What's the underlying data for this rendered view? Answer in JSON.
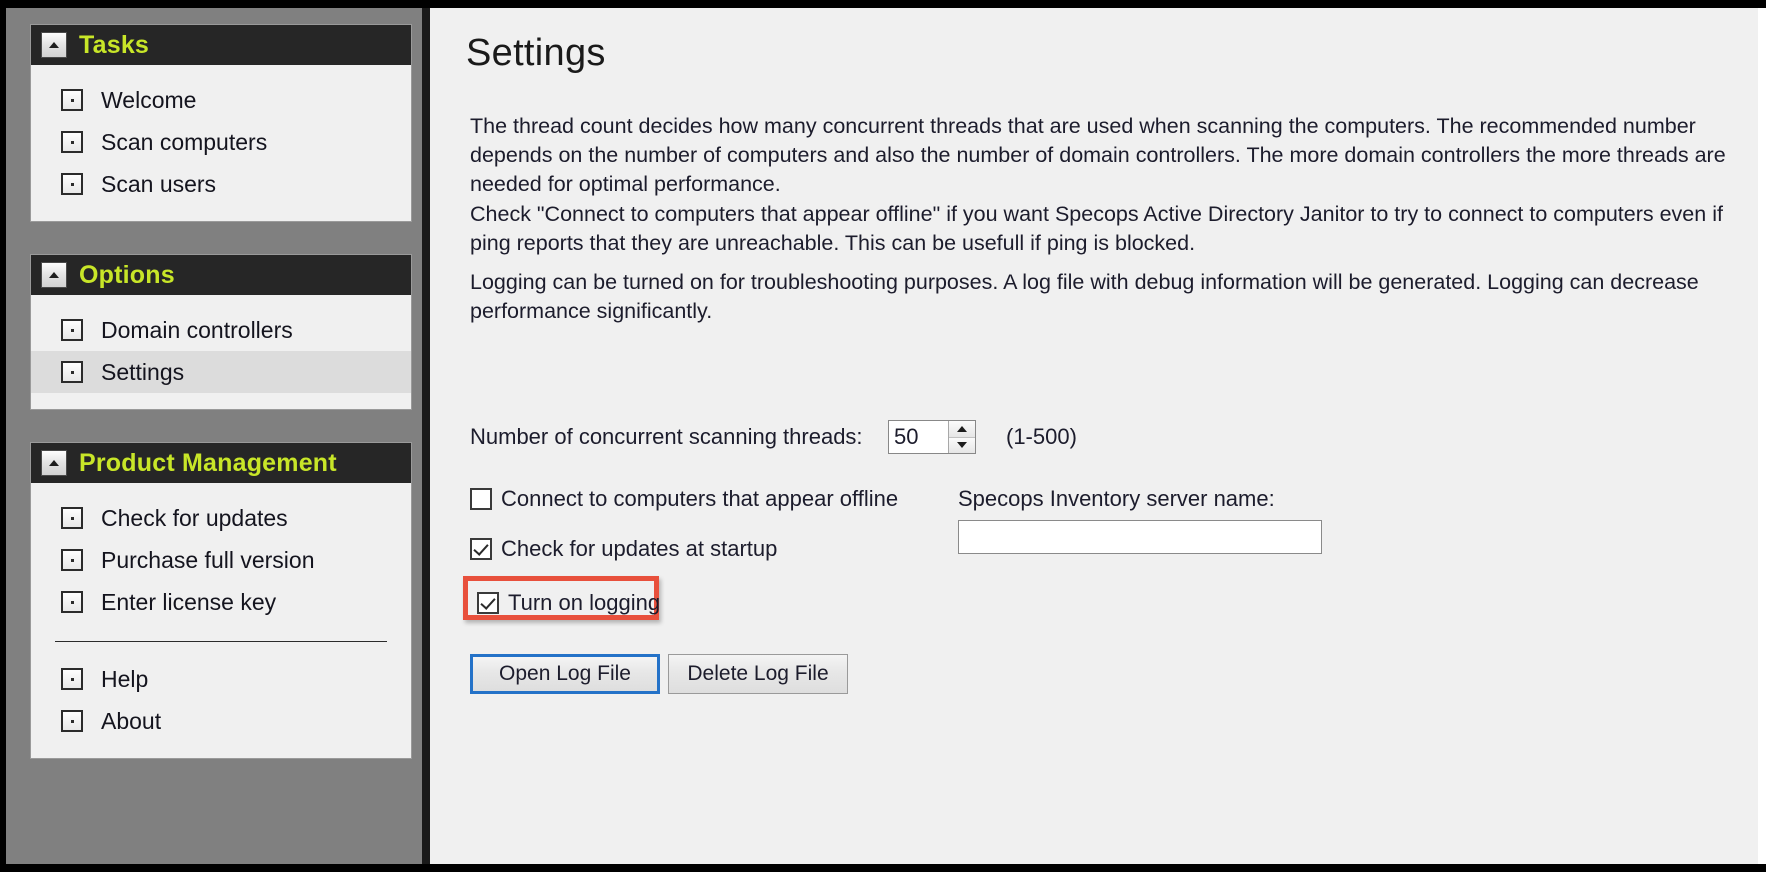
{
  "sidebar": {
    "groups": [
      {
        "title": "Tasks",
        "collapse_icon": "chevron-up-icon",
        "items": [
          {
            "label": "Welcome",
            "icon": "bullet-square-icon",
            "selected": false
          },
          {
            "label": "Scan computers",
            "icon": "bullet-square-icon",
            "selected": false
          },
          {
            "label": "Scan users",
            "icon": "bullet-square-icon",
            "selected": false
          }
        ]
      },
      {
        "title": "Options",
        "collapse_icon": "chevron-up-icon",
        "items": [
          {
            "label": "Domain controllers",
            "icon": "bullet-square-icon",
            "selected": false
          },
          {
            "label": "Settings",
            "icon": "bullet-square-icon",
            "selected": true
          }
        ]
      },
      {
        "title": "Product Management",
        "collapse_icon": "chevron-up-icon",
        "items": [
          {
            "label": "Check for updates",
            "icon": "bullet-square-icon",
            "selected": false
          },
          {
            "label": "Purchase full version",
            "icon": "bullet-square-icon",
            "selected": false
          },
          {
            "label": "Enter license key",
            "icon": "bullet-square-icon",
            "selected": false
          }
        ],
        "items_after_separator": [
          {
            "label": "Help",
            "icon": "bullet-square-icon",
            "selected": false
          },
          {
            "label": "About",
            "icon": "bullet-square-icon",
            "selected": false
          }
        ]
      }
    ]
  },
  "main": {
    "title": "Settings",
    "paragraphs": [
      "The thread count decides how many concurrent threads that are used when scanning the computers. The recommended number depends on the number of computers and also the number of domain controllers. The more domain controllers the more threads are needed for optimal performance.",
      "Check \"Connect to computers that appear offline\" if you want Specops Active Directory Janitor to try to connect to computers even if ping reports that they are unreachable. This can be usefull if ping is blocked.",
      "Logging can be turned on for troubleshooting purposes. A log file with debug information will be generated. Logging can decrease performance significantly."
    ],
    "thread_count": {
      "label": "Number of concurrent scanning threads:",
      "value": "50",
      "range": "(1-500)",
      "spin_up_icon": "triangle-up-icon",
      "spin_down_icon": "triangle-down-icon"
    },
    "checkboxes": [
      {
        "label": "Connect to computers that appear offline",
        "checked": false
      },
      {
        "label": "Check for updates at startup",
        "checked": true
      },
      {
        "label": "Turn on logging",
        "checked": true,
        "highlighted": true
      }
    ],
    "inventory": {
      "label": "Specops Inventory server name:",
      "value": "",
      "placeholder": ""
    },
    "buttons": [
      {
        "label": "Open Log File",
        "focused": true
      },
      {
        "label": "Delete Log File",
        "focused": false
      }
    ]
  },
  "colors": {
    "group_header_bg": "#262626",
    "group_title_text": "#c8e628",
    "sidebar_bg": "#808080",
    "content_bg": "#f0f0f0",
    "highlight_border": "#e8503c",
    "focus_border": "#2472c8",
    "selected_item_bg": "#dcdcdc"
  }
}
